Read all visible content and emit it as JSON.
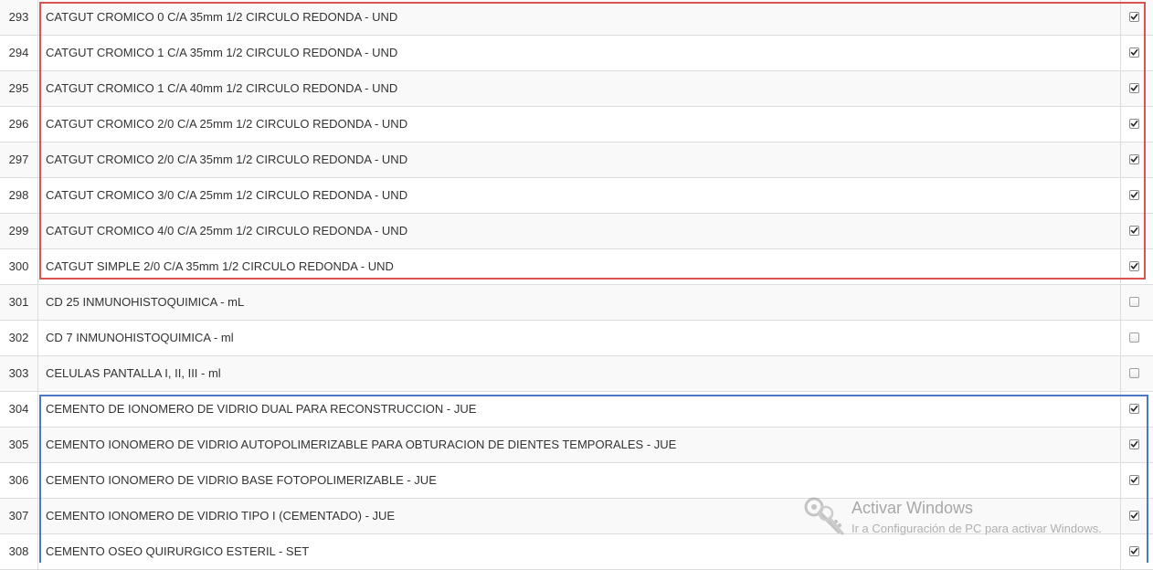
{
  "rows": [
    {
      "num": "293",
      "desc": "CATGUT CROMICO 0 C/A 35mm 1/2 CIRCULO REDONDA - UND",
      "checked": true
    },
    {
      "num": "294",
      "desc": "CATGUT CROMICO 1 C/A 35mm 1/2 CIRCULO REDONDA - UND",
      "checked": true
    },
    {
      "num": "295",
      "desc": "CATGUT CROMICO 1 C/A 40mm 1/2 CIRCULO REDONDA - UND",
      "checked": true
    },
    {
      "num": "296",
      "desc": "CATGUT CROMICO 2/0 C/A 25mm 1/2 CIRCULO REDONDA - UND",
      "checked": true
    },
    {
      "num": "297",
      "desc": "CATGUT CROMICO 2/0 C/A 35mm 1/2 CIRCULO REDONDA - UND",
      "checked": true
    },
    {
      "num": "298",
      "desc": "CATGUT CROMICO 3/0 C/A 25mm 1/2 CIRCULO REDONDA - UND",
      "checked": true
    },
    {
      "num": "299",
      "desc": "CATGUT CROMICO 4/0 C/A 25mm 1/2 CIRCULO REDONDA - UND",
      "checked": true
    },
    {
      "num": "300",
      "desc": "CATGUT SIMPLE 2/0 C/A 35mm 1/2 CIRCULO REDONDA - UND",
      "checked": true
    },
    {
      "num": "301",
      "desc": "CD 25 INMUNOHISTOQUIMICA - mL",
      "checked": false
    },
    {
      "num": "302",
      "desc": "CD 7 INMUNOHISTOQUIMICA - ml",
      "checked": false
    },
    {
      "num": "303",
      "desc": "CELULAS PANTALLA I, II, III - ml",
      "checked": false
    },
    {
      "num": "304",
      "desc": "CEMENTO DE IONOMERO DE VIDRIO DUAL PARA RECONSTRUCCION - JUE",
      "checked": true
    },
    {
      "num": "305",
      "desc": "CEMENTO IONOMERO DE VIDRIO AUTOPOLIMERIZABLE PARA OBTURACION DE DIENTES TEMPORALES - JUE",
      "checked": true
    },
    {
      "num": "306",
      "desc": "CEMENTO IONOMERO DE VIDRIO BASE FOTOPOLIMERIZABLE - JUE",
      "checked": true
    },
    {
      "num": "307",
      "desc": "CEMENTO IONOMERO DE VIDRIO TIPO I (CEMENTADO) - JUE",
      "checked": true
    },
    {
      "num": "308",
      "desc": "CEMENTO OSEO QUIRURGICO ESTERIL - SET",
      "checked": true
    }
  ],
  "highlight_colors": {
    "red": "#d9534f",
    "blue": "#4a78c2"
  },
  "watermark": {
    "title": "Activar Windows",
    "subtitle": "Ir a Configuración de PC para activar Windows."
  }
}
